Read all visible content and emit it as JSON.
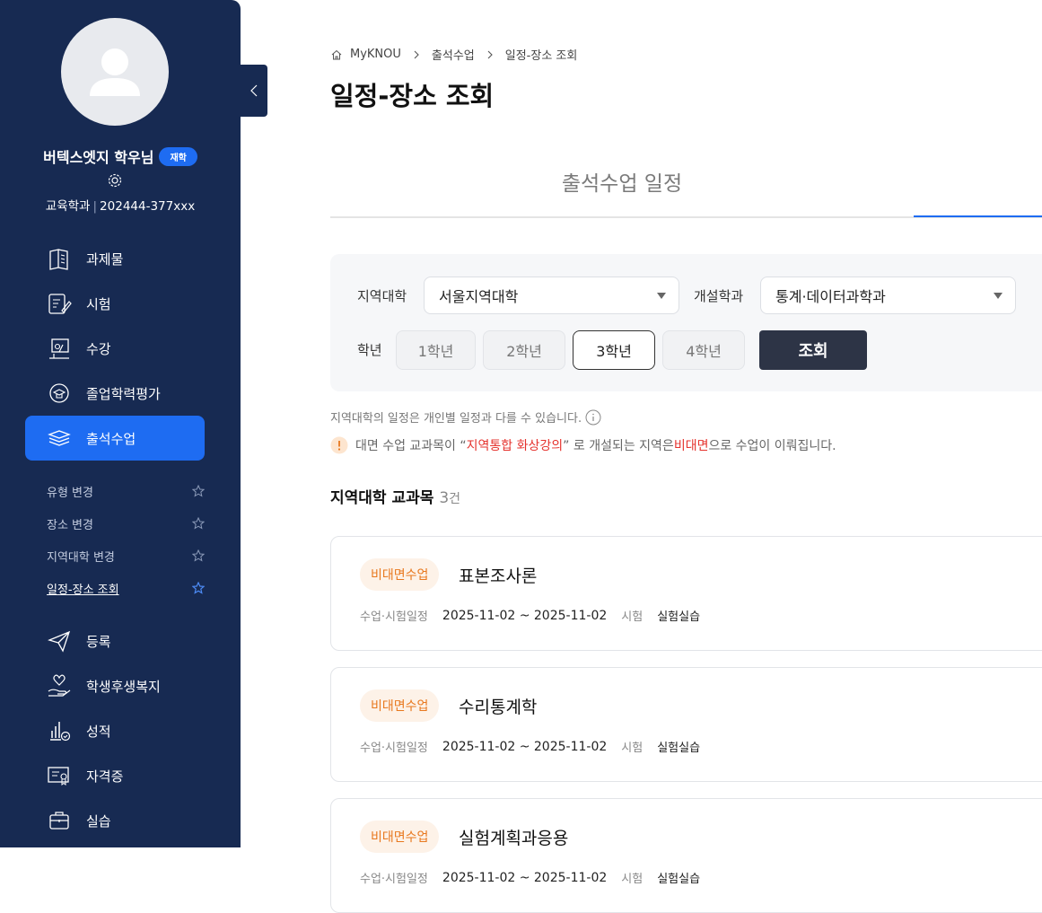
{
  "profile": {
    "name": "버텍스엣지 학우님",
    "status_badge": "재학",
    "department": "교육학과",
    "separator": "|",
    "student_id": "202444-377xxx"
  },
  "sidebar": {
    "menu_top": [
      {
        "label": "과제물",
        "icon": "book-icon"
      },
      {
        "label": "시험",
        "icon": "exam-icon"
      },
      {
        "label": "수강",
        "icon": "lecture-icon"
      },
      {
        "label": "졸업학력평가",
        "icon": "graduation-eval-icon"
      },
      {
        "label": "출석수업",
        "icon": "attendance-icon",
        "active": true
      }
    ],
    "submenu": [
      {
        "label": "유형 변경"
      },
      {
        "label": "장소 변경"
      },
      {
        "label": "지역대학 변경"
      },
      {
        "label": "일정-장소 조회",
        "current": true
      }
    ],
    "menu_bottom": [
      {
        "label": "등록",
        "icon": "paper-plane-icon"
      },
      {
        "label": "학생후생복지",
        "icon": "welfare-icon"
      },
      {
        "label": "성적",
        "icon": "grades-icon"
      },
      {
        "label": "자격증",
        "icon": "certificate-icon"
      },
      {
        "label": "실습",
        "icon": "briefcase-icon"
      }
    ]
  },
  "breadcrumb": [
    "MyKNOU",
    "출석수업",
    "일정-장소 조회"
  ],
  "page_title": "일정-장소 조회",
  "tab_label": "출석수업 일정",
  "filters": {
    "region_label": "지역대학",
    "region_value": "서울지역대학",
    "dept_label": "개설학과",
    "dept_value": "통계·데이터과학과",
    "grade_label": "학년",
    "grades": [
      "1학년",
      "2학년",
      "3학년",
      "4학년"
    ],
    "selected_grade": "3학년",
    "search_button": "조회"
  },
  "notices": {
    "line1": "지역대학의 일정은 개인별 일정과 다를 수 있습니다.",
    "line2_part1": "대면 수업 교과목이 “",
    "line2_highlight1": "지역통합 화상강의",
    "line2_part2": "” 로 개설되는 지역은 ",
    "line2_highlight2": "비대면",
    "line2_part3": "으로 수업이 이뤄집니다."
  },
  "section": {
    "title": "지역대학 교과목",
    "count": "3",
    "count_unit": "건"
  },
  "courses": [
    {
      "tag": "비대면수업",
      "name": "표본조사론",
      "schedule_label": "수업·시험일정",
      "schedule": "2025-11-02 ~ 2025-11-02",
      "exam_label": "시험",
      "exam": "실험실습"
    },
    {
      "tag": "비대면수업",
      "name": "수리통계학",
      "schedule_label": "수업·시험일정",
      "schedule": "2025-11-02 ~ 2025-11-02",
      "exam_label": "시험",
      "exam": "실험실습"
    },
    {
      "tag": "비대면수업",
      "name": "실험계획과응용",
      "schedule_label": "수업·시험일정",
      "schedule": "2025-11-02 ~ 2025-11-02",
      "exam_label": "시험",
      "exam": "실험실습"
    }
  ],
  "colors": {
    "sidebar_bg": "#172a52",
    "accent": "#1e6cf2",
    "search_button": "#2d3446",
    "tag_text": "#e8781e",
    "highlight_red": "#e5322d"
  }
}
